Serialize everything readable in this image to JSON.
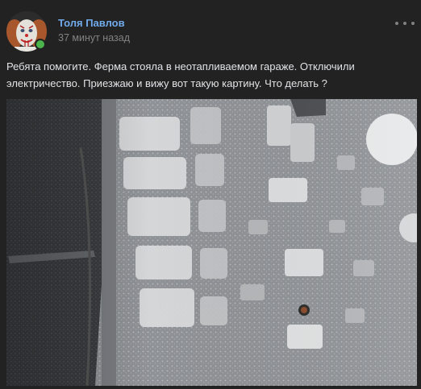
{
  "post": {
    "author": "Толя Павлов",
    "time": "37 минут назад",
    "text_line1": "Ребята помогите. Ферма стояла в неотапливаемом гараже. Отключили",
    "text_line2": "электричество. Приезжаю и вижу вот такую картину. Что делать ?",
    "online": true
  },
  "icons": {
    "more": "more-horizontal-icon",
    "avatar": "clown-avatar"
  },
  "colors": {
    "background": "#222222",
    "author": "#71aaeb",
    "text": "#e1e3e6",
    "muted": "#828282",
    "online": "#4bb34b"
  }
}
